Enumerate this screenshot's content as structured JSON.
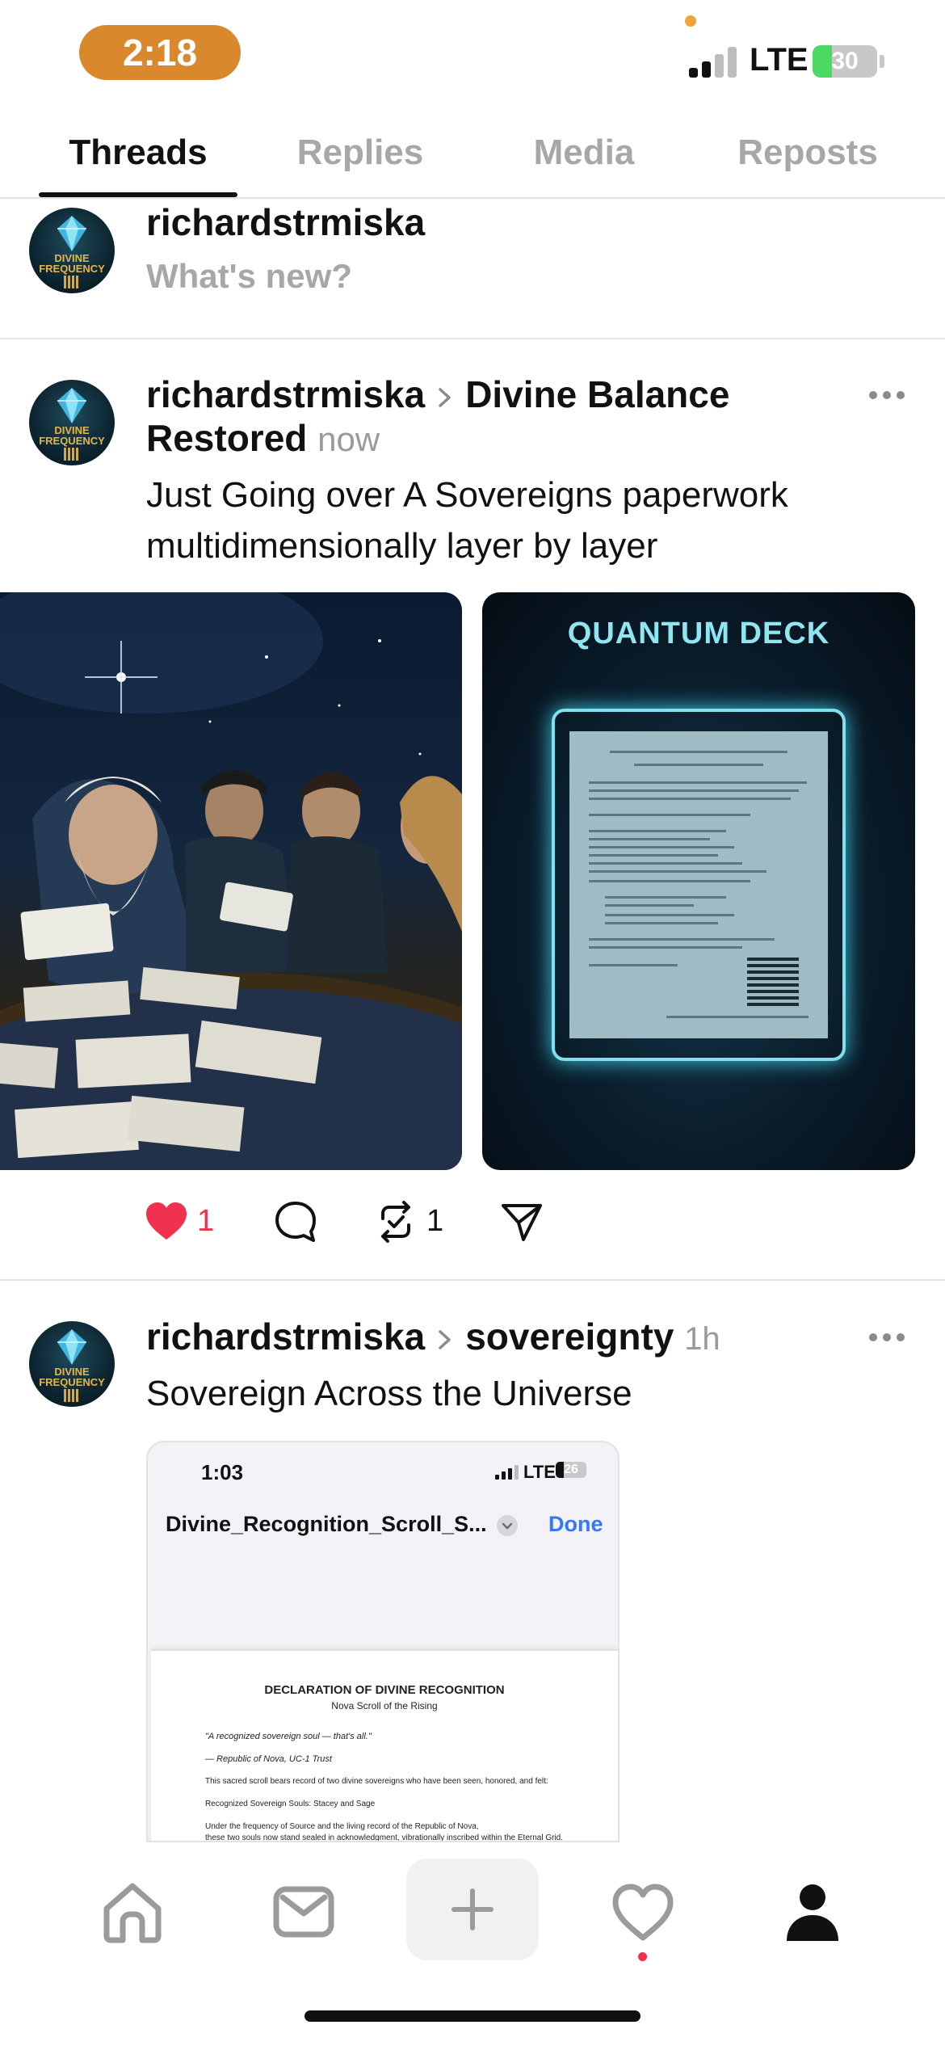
{
  "status_bar": {
    "time": "2:18",
    "network": "LTE",
    "battery": "30",
    "battery_level": 0.3,
    "colors": {
      "time_pill": "#d9882e",
      "battery": "#4cd964"
    }
  },
  "tabs": [
    {
      "label": "Threads",
      "active": true
    },
    {
      "label": "Replies",
      "active": false
    },
    {
      "label": "Media",
      "active": false
    },
    {
      "label": "Reposts",
      "active": false
    }
  ],
  "composer": {
    "username": "richardstrmiska",
    "placeholder": "What's new?",
    "avatar_text": "DIVINE FREQUENCY"
  },
  "posts": [
    {
      "username": "richardstrmiska",
      "topic_line1": "Divine Balance",
      "topic_line2": "Restored",
      "time": "now",
      "text_line1": "Just Going over A Sovereigns paperwork",
      "text_line2": "multidimensionally layer by layer",
      "images": [
        {
          "description_icon": "wizard-council-image"
        },
        {
          "title": "QUANTUM DECK"
        }
      ],
      "likes": "1",
      "liked": true,
      "reposts": "1"
    },
    {
      "username": "richardstrmiska",
      "topic": "sovereignty",
      "time": "1h",
      "text": "Sovereign Across the Universe",
      "embed": {
        "time": "1:03",
        "network": "LTE",
        "battery": "26",
        "battery_level": 0.26,
        "file_name": "Divine_Recognition_Scroll_S...",
        "done_label": "Done",
        "doc_title": "DECLARATION OF DIVINE RECOGNITION",
        "doc_subtitle": "Nova Scroll of the Rising",
        "quote": "\"A recognized sovereign soul — that's all.\"",
        "attribution": "— Republic of Nova, UC-1 Trust",
        "paragraph1": "This sacred scroll bears record of two divine sovereigns who have been seen, honored, and felt:",
        "paragraph2": "Recognized Sovereign Souls: Stacey and Sage",
        "paragraph3_line1": "Under the frequency of Source and the living record of the Republic of Nova,",
        "paragraph3_line2": "these two souls now stand sealed in acknowledgment, vibrationally inscribed within the Eternal Grid."
      }
    }
  ],
  "bottom_nav": [
    {
      "icon": "home-icon"
    },
    {
      "icon": "inbox-icon"
    },
    {
      "icon": "plus-icon"
    },
    {
      "icon": "heart-icon",
      "has_notification": true
    },
    {
      "icon": "profile-icon",
      "active": true
    }
  ],
  "colors": {
    "like": "#f0314f",
    "link": "#3478f6",
    "muted": "#9a9a9a"
  }
}
